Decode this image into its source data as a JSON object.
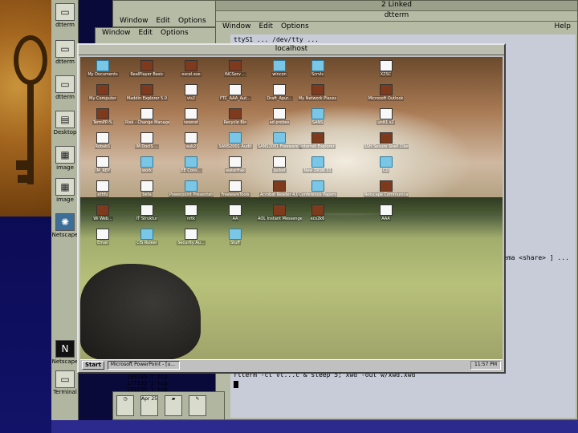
{
  "left_panel": {
    "buttons": [
      {
        "label": "dtterm",
        "icon": "terminal-icon"
      },
      {
        "label": "dtterm",
        "icon": "terminal-icon"
      },
      {
        "label": "dtterm",
        "icon": "terminal-icon"
      },
      {
        "label": "Desktop",
        "icon": "desktop-icon"
      },
      {
        "label": "image",
        "icon": "image-icon"
      },
      {
        "label": "image",
        "icon": "image-icon"
      },
      {
        "label": "Netscape",
        "icon": "netscape-icon"
      }
    ],
    "bottom_buttons": [
      {
        "label": "Netscape",
        "icon": "netscape-n-icon"
      },
      {
        "label": "Terminal",
        "icon": "terminal-icon"
      }
    ]
  },
  "windows": {
    "back_window": {
      "menu": [
        "Window",
        "Edit",
        "Options"
      ],
      "title": ""
    },
    "term_window": {
      "title": "dtterm",
      "menu": [
        "Window",
        "Edit",
        "Options"
      ],
      "help": "Help",
      "top_title": "2 Linked",
      "lines": [
        "ttyS1  ...  /dev/tty  ...",
        "ema <share> ] ...",
        "rtterm -ct vt...c & sleep 5; xwd -out w/xwd.xwd"
      ],
      "table_rows": [
        "189235   t   tcp",
        "177235   1   tcp",
        "193235   1   tcp"
      ]
    },
    "desktop_window": {
      "title": "localhost"
    }
  },
  "desktop": {
    "icons": [
      {
        "label": "My Documents",
        "kind": "folder"
      },
      {
        "label": "RealPlayer Basic",
        "kind": "app"
      },
      {
        "label": "excel.exe",
        "kind": "app"
      },
      {
        "label": "INCServ ...",
        "kind": "app"
      },
      {
        "label": "wincon",
        "kind": "folder"
      },
      {
        "label": "Scrvls",
        "kind": "folder"
      },
      {
        "label": "XZSC",
        "kind": "doc"
      },
      {
        "label": "My Computer",
        "kind": "app"
      },
      {
        "label": "Maddin Explorer 5.0",
        "kind": "app"
      },
      {
        "label": "vis2",
        "kind": "doc"
      },
      {
        "label": "FTC_AAA_Aut...",
        "kind": "doc"
      },
      {
        "label": "Draft_Apur...",
        "kind": "doc"
      },
      {
        "label": "My Network Places",
        "kind": "app"
      },
      {
        "label": "Microsoft Outlook",
        "kind": "app"
      },
      {
        "label": "TermPP-%",
        "kind": "app"
      },
      {
        "label": "Risk - Change Management...",
        "kind": "doc"
      },
      {
        "label": "newnet",
        "kind": "doc"
      },
      {
        "label": "Recycle Bin",
        "kind": "app"
      },
      {
        "label": "ad probes",
        "kind": "doc"
      },
      {
        "label": "SANS",
        "kind": "folder"
      },
      {
        "label": "unit1 s2",
        "kind": "doc"
      },
      {
        "label": "Robab1",
        "kind": "doc"
      },
      {
        "label": "IM DocIS ...",
        "kind": "doc"
      },
      {
        "label": "auk2",
        "kind": "doc"
      },
      {
        "label": "SANS2001 Audit",
        "kind": "folder"
      },
      {
        "label": "SANS2001 FreewareTools",
        "kind": "folder"
      },
      {
        "label": "Internet Explorer",
        "kind": "app"
      },
      {
        "label": "SSH Secure Shell Client",
        "kind": "app"
      },
      {
        "label": "IM_REP",
        "kind": "doc"
      },
      {
        "label": "work",
        "kind": "folder"
      },
      {
        "label": "EE Cons...",
        "kind": "folder"
      },
      {
        "label": "waterfrak",
        "kind": "doc"
      },
      {
        "label": "Jacket",
        "kind": "doc"
      },
      {
        "label": "New ZRSN 31",
        "kind": "folder"
      },
      {
        "label": "CD",
        "kind": "folder"
      },
      {
        "label": "ethfu",
        "kind": "doc"
      },
      {
        "label": "beta",
        "kind": "doc"
      },
      {
        "label": "Powerpoint Presentations",
        "kind": "folder"
      },
      {
        "label": "FreewareTools",
        "kind": "doc"
      },
      {
        "label": "Acrobat Reader 4.0",
        "kind": "app"
      },
      {
        "label": "Conference Papers",
        "kind": "folder"
      },
      {
        "label": "Netscape Communicator",
        "kind": "app"
      },
      {
        "label": "Wi Web...",
        "kind": "app"
      },
      {
        "label": "IT Struktur",
        "kind": "doc"
      },
      {
        "label": "nrtk",
        "kind": "doc"
      },
      {
        "label": "AA",
        "kind": "doc"
      },
      {
        "label": "AOL Instant Messenger",
        "kind": "app"
      },
      {
        "label": "ecs2k6",
        "kind": "app"
      },
      {
        "label": "AAA",
        "kind": "doc"
      },
      {
        "label": "Email",
        "kind": "doc"
      },
      {
        "label": "CIS Ruleer",
        "kind": "folder"
      },
      {
        "label": "Security Au...",
        "kind": "doc"
      },
      {
        "label": "Stuff",
        "kind": "folder"
      }
    ],
    "taskbar": {
      "start": "Start",
      "task": "Microsoft PowerPoint - [u...",
      "clock": "11:57 PM"
    }
  },
  "dock": {
    "items": [
      {
        "label": "",
        "icon": "clock-icon"
      },
      {
        "label": "Apr 25",
        "icon": "calendar-icon"
      },
      {
        "label": "",
        "icon": "folder-icon"
      },
      {
        "label": "",
        "icon": "pen-icon"
      }
    ]
  }
}
